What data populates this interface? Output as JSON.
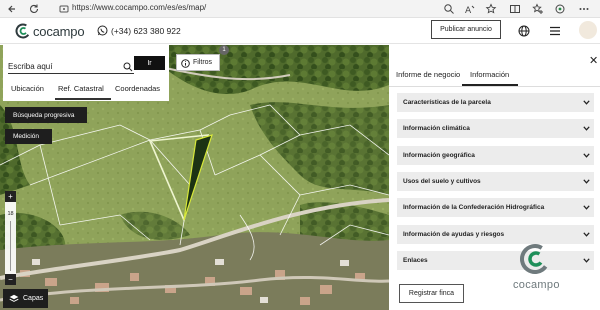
{
  "browser": {
    "url": "https://www.cocampo.com/es/es/map/"
  },
  "header": {
    "logo_text": "cocampo",
    "phone": "(+34) 623 380 922",
    "publish_label": "Publicar anuncio"
  },
  "search_panel": {
    "placeholder": "Escriba aquí",
    "go_label": "Ir",
    "tabs": [
      "Ubicación",
      "Ref. Catastral",
      "Coordenadas"
    ],
    "active_tab": "Ref. Catastral"
  },
  "filters": {
    "label": "Filtros",
    "badge": "1"
  },
  "map_controls": {
    "progressive_search": "Búsqueda progresiva",
    "measure": "Medición",
    "zoom_in": "+",
    "zoom_out": "−",
    "zoom_level": "18",
    "layers": "Capas"
  },
  "right_panel": {
    "tabs": [
      "Informe de negocio",
      "Información"
    ],
    "active_tab": "Información",
    "sections": [
      "Características de la parcela",
      "Información climática",
      "Información geográfica",
      "Usos del suelo y cultivos",
      "Información de la Confederación Hidrográfica",
      "Información de ayudas y riesgos",
      "Enlaces"
    ],
    "register_label": "Registrar finca",
    "watermark": "cocampo"
  },
  "colors": {
    "brand": "#2e3a3d",
    "accent_green": "#1f8f5a",
    "parcel_outline": "#d7e83a"
  }
}
